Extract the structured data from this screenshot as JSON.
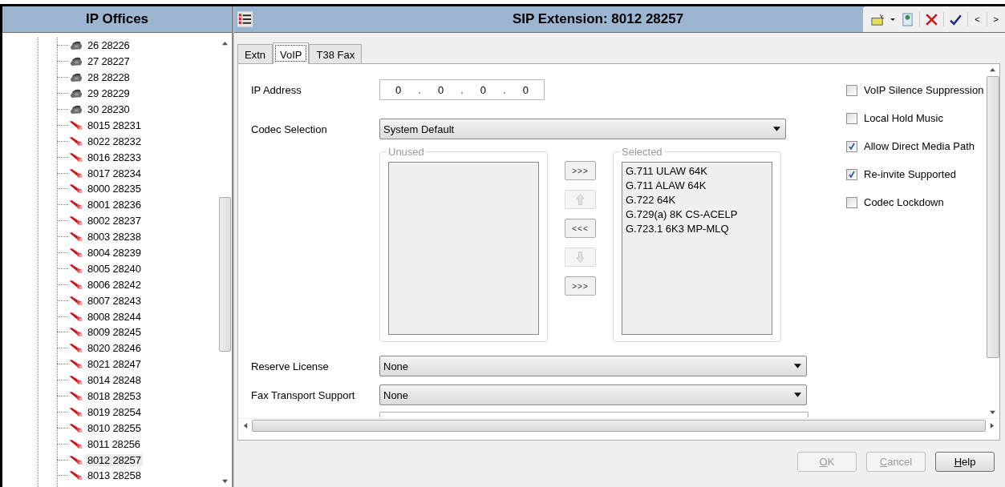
{
  "sidebar": {
    "title": "IP Offices",
    "items": [
      {
        "label": "26 28226",
        "kind": "phone",
        "selected": false
      },
      {
        "label": "27 28227",
        "kind": "phone",
        "selected": false
      },
      {
        "label": "28 28228",
        "kind": "phone",
        "selected": false
      },
      {
        "label": "29 28229",
        "kind": "phone",
        "selected": false
      },
      {
        "label": "30 28230",
        "kind": "phone",
        "selected": false
      },
      {
        "label": "8015 28231",
        "kind": "sip",
        "selected": false
      },
      {
        "label": "8022 28232",
        "kind": "sip",
        "selected": false
      },
      {
        "label": "8016 28233",
        "kind": "sip",
        "selected": false
      },
      {
        "label": "8017 28234",
        "kind": "sip",
        "selected": false
      },
      {
        "label": "8000 28235",
        "kind": "sip",
        "selected": false
      },
      {
        "label": "8001 28236",
        "kind": "sip",
        "selected": false
      },
      {
        "label": "8002 28237",
        "kind": "sip",
        "selected": false
      },
      {
        "label": "8003 28238",
        "kind": "sip",
        "selected": false
      },
      {
        "label": "8004 28239",
        "kind": "sip",
        "selected": false
      },
      {
        "label": "8005 28240",
        "kind": "sip",
        "selected": false
      },
      {
        "label": "8006 28242",
        "kind": "sip",
        "selected": false
      },
      {
        "label": "8007 28243",
        "kind": "sip",
        "selected": false
      },
      {
        "label": "8008 28244",
        "kind": "sip",
        "selected": false
      },
      {
        "label": "8009 28245",
        "kind": "sip",
        "selected": false
      },
      {
        "label": "8020 28246",
        "kind": "sip",
        "selected": false
      },
      {
        "label": "8021 28247",
        "kind": "sip",
        "selected": false
      },
      {
        "label": "8014 28248",
        "kind": "sip",
        "selected": false
      },
      {
        "label": "8018 28253",
        "kind": "sip",
        "selected": false
      },
      {
        "label": "8019 28254",
        "kind": "sip",
        "selected": false
      },
      {
        "label": "8010 28255",
        "kind": "sip",
        "selected": false
      },
      {
        "label": "8011 28256",
        "kind": "sip",
        "selected": false
      },
      {
        "label": "8012 28257",
        "kind": "sip",
        "selected": true
      },
      {
        "label": "8013 28258",
        "kind": "sip",
        "selected": false
      }
    ]
  },
  "window": {
    "title": "SIP Extension: 8012 28257",
    "toolbar": [
      {
        "kind": "new"
      },
      {
        "kind": "dropdown"
      },
      {
        "kind": "export"
      },
      {
        "kind": "delete"
      },
      {
        "kind": "validate"
      },
      {
        "kind": "prev",
        "label": "<"
      },
      {
        "kind": "next",
        "label": ">"
      }
    ]
  },
  "tabs": [
    {
      "label": "Extn",
      "selected": false
    },
    {
      "label": "VoIP",
      "selected": true
    },
    {
      "label": "T38 Fax",
      "selected": false
    }
  ],
  "ip_address": {
    "label": "IP Address",
    "octets": [
      "0",
      "0",
      "0",
      "0"
    ]
  },
  "codec_selection": {
    "label": "Codec Selection",
    "value": "System Default"
  },
  "unused": {
    "title": "Unused"
  },
  "move_buttons": [
    {
      "kind": "text",
      "label": ">>>",
      "disabled": false
    },
    {
      "kind": "up",
      "disabled": true
    },
    {
      "kind": "text",
      "label": "<<<",
      "disabled": false
    },
    {
      "kind": "down",
      "disabled": true
    },
    {
      "kind": "text",
      "label": ">>>",
      "disabled": false
    }
  ],
  "selected": {
    "title": "Selected",
    "items": [
      "G.711 ULAW 64K",
      "G.711 ALAW 64K",
      "G.722 64K",
      "G.729(a) 8K CS-ACELP",
      "G.723.1 6K3 MP-MLQ"
    ]
  },
  "options": [
    {
      "label": "VoIP Silence Suppression",
      "checked": false
    },
    {
      "label": "Local Hold Music",
      "checked": false
    },
    {
      "label": "Allow Direct Media Path",
      "checked": true
    },
    {
      "label": "Re-invite Supported",
      "checked": true
    },
    {
      "label": "Codec Lockdown",
      "checked": false
    }
  ],
  "reserve_license": {
    "label": "Reserve License",
    "value": "None"
  },
  "fax_transport": {
    "label": "Fax Transport Support",
    "value": "None"
  },
  "buttons": [
    {
      "label": "OK",
      "disabled": true
    },
    {
      "label": "Cancel",
      "disabled": true
    },
    {
      "label": "Help",
      "disabled": false
    }
  ]
}
